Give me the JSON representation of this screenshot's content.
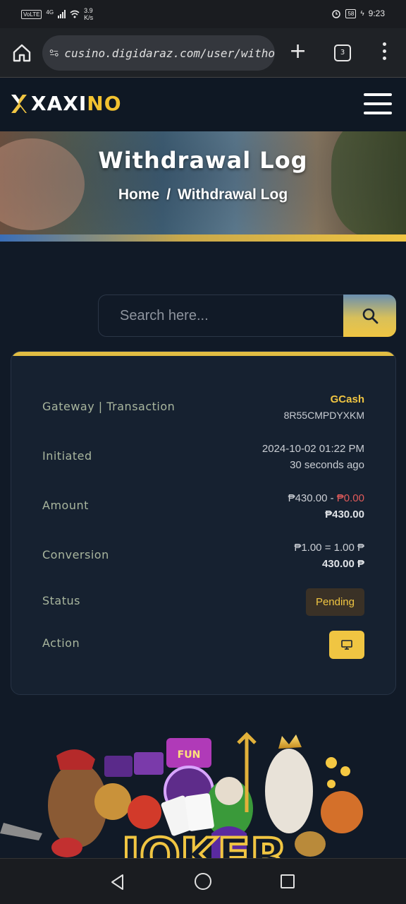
{
  "status_bar": {
    "volte": "VoLTE",
    "network": "4G",
    "speed": "3.9\nK/s",
    "battery": "58",
    "time": "9:23"
  },
  "browser": {
    "url": "cusino.digidaraz.com/user/witho",
    "tab_count": "3"
  },
  "site": {
    "logo_x": "X",
    "logo_text_white": "XAXI",
    "logo_text_gold": "NO"
  },
  "banner": {
    "title": "Withdrawal Log",
    "breadcrumb_home": "Home",
    "breadcrumb_sep": "/",
    "breadcrumb_current": "Withdrawal Log"
  },
  "search": {
    "placeholder": "Search here..."
  },
  "withdrawal": {
    "gateway_label": "Gateway | Transaction",
    "gateway": "GCash",
    "transaction_id": "8R55CMPDYXKM",
    "initiated_label": "Initiated",
    "initiated_datetime": "2024-10-02 01:22 PM",
    "initiated_relative": "30 seconds ago",
    "amount_label": "Amount",
    "amount": "₱430.00",
    "amount_sep": " - ",
    "charge": "₱0.00",
    "amount_total": "₱430.00",
    "conversion_label": "Conversion",
    "conversion_rate": "₱1.00 = 1.00 ₱",
    "conversion_total": "430.00 ₱",
    "status_label": "Status",
    "status": "Pending",
    "action_label": "Action"
  },
  "promo": {
    "brand_fragment": "JOKER",
    "sign_text": "FUN"
  },
  "colors": {
    "accent": "#f0c542",
    "background": "#111a27",
    "card": "#162130",
    "charge_red": "#e05a5a"
  }
}
